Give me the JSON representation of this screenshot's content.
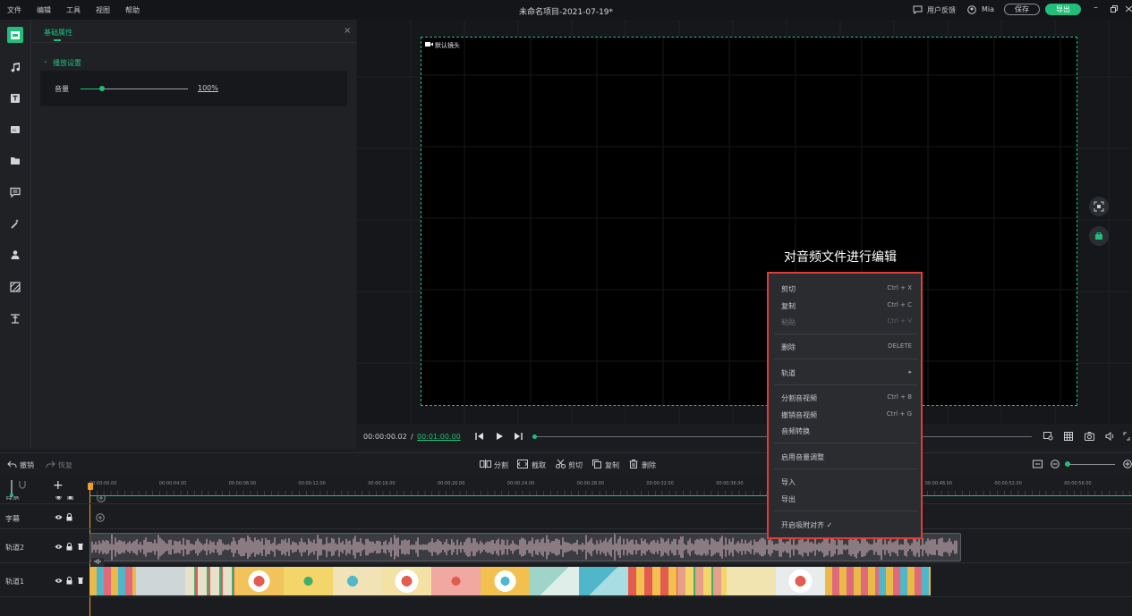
{
  "menu": [
    "文件",
    "编辑",
    "工具",
    "视图",
    "帮助"
  ],
  "window_title": "未命名项目-2021-07-19*",
  "topbar": {
    "feedback": "用户反馈",
    "user": "Mia",
    "save": "保存",
    "export": "导出"
  },
  "props": {
    "tab": "基础属性",
    "section": "播放设置",
    "volume_label": "音量",
    "volume_value": "100%",
    "volume_level": 0.2
  },
  "preview": {
    "camera_label": "默认镜头",
    "annotation": "对音频文件进行编辑",
    "time_current": "00:00:00.02",
    "time_sep": "/",
    "time_total": "00:01:00.00"
  },
  "context_menu": [
    {
      "label": "剪切",
      "shortcut": "Ctrl + X",
      "disabled": false
    },
    {
      "label": "复制",
      "shortcut": "Ctrl + C",
      "disabled": false
    },
    {
      "label": "粘贴",
      "shortcut": "Ctrl + V",
      "disabled": true
    },
    {
      "label": "删除",
      "shortcut": "DELETE",
      "disabled": false
    },
    {
      "label": "轨道",
      "shortcut": "▸",
      "disabled": false
    },
    {
      "label": "分割音视频",
      "shortcut": "Ctrl + B",
      "disabled": false
    },
    {
      "label": "撤销音视频",
      "shortcut": "Ctrl + G",
      "disabled": false
    },
    {
      "label": "音频转换",
      "shortcut": "",
      "disabled": false
    },
    {
      "label": "启用音量调整",
      "shortcut": "",
      "disabled": false
    },
    {
      "label": "导入",
      "shortcut": "",
      "disabled": false
    },
    {
      "label": "导出",
      "shortcut": "",
      "disabled": false
    },
    {
      "label": "开启吸附对齐 ✓",
      "shortcut": "",
      "disabled": false
    }
  ],
  "timeline_toolbar": {
    "undo": "撤销",
    "redo": "恢复",
    "split": "分割",
    "crop": "截取",
    "cut": "剪切",
    "copy": "复制",
    "delete": "删除"
  },
  "ruler": [
    "00:00:00.00",
    "00:00:04.00",
    "00:00:08.00",
    "00:00:12.00",
    "00:00:16.00",
    "00:00:20.00",
    "00:00:24.00",
    "00:00:28.00",
    "00:00:32.00",
    "00:00:36.00",
    "",
    "",
    "00:00:48.00",
    "00:00:52.00",
    "00:00:56.00"
  ],
  "tracks": {
    "bg": "背景",
    "subtitle": "字幕",
    "track2": "轨道2",
    "track1": "轨道1"
  },
  "colors": {
    "accent": "#1fbf7a",
    "highlight": "#e23b3b",
    "playhead": "#f0a020"
  }
}
